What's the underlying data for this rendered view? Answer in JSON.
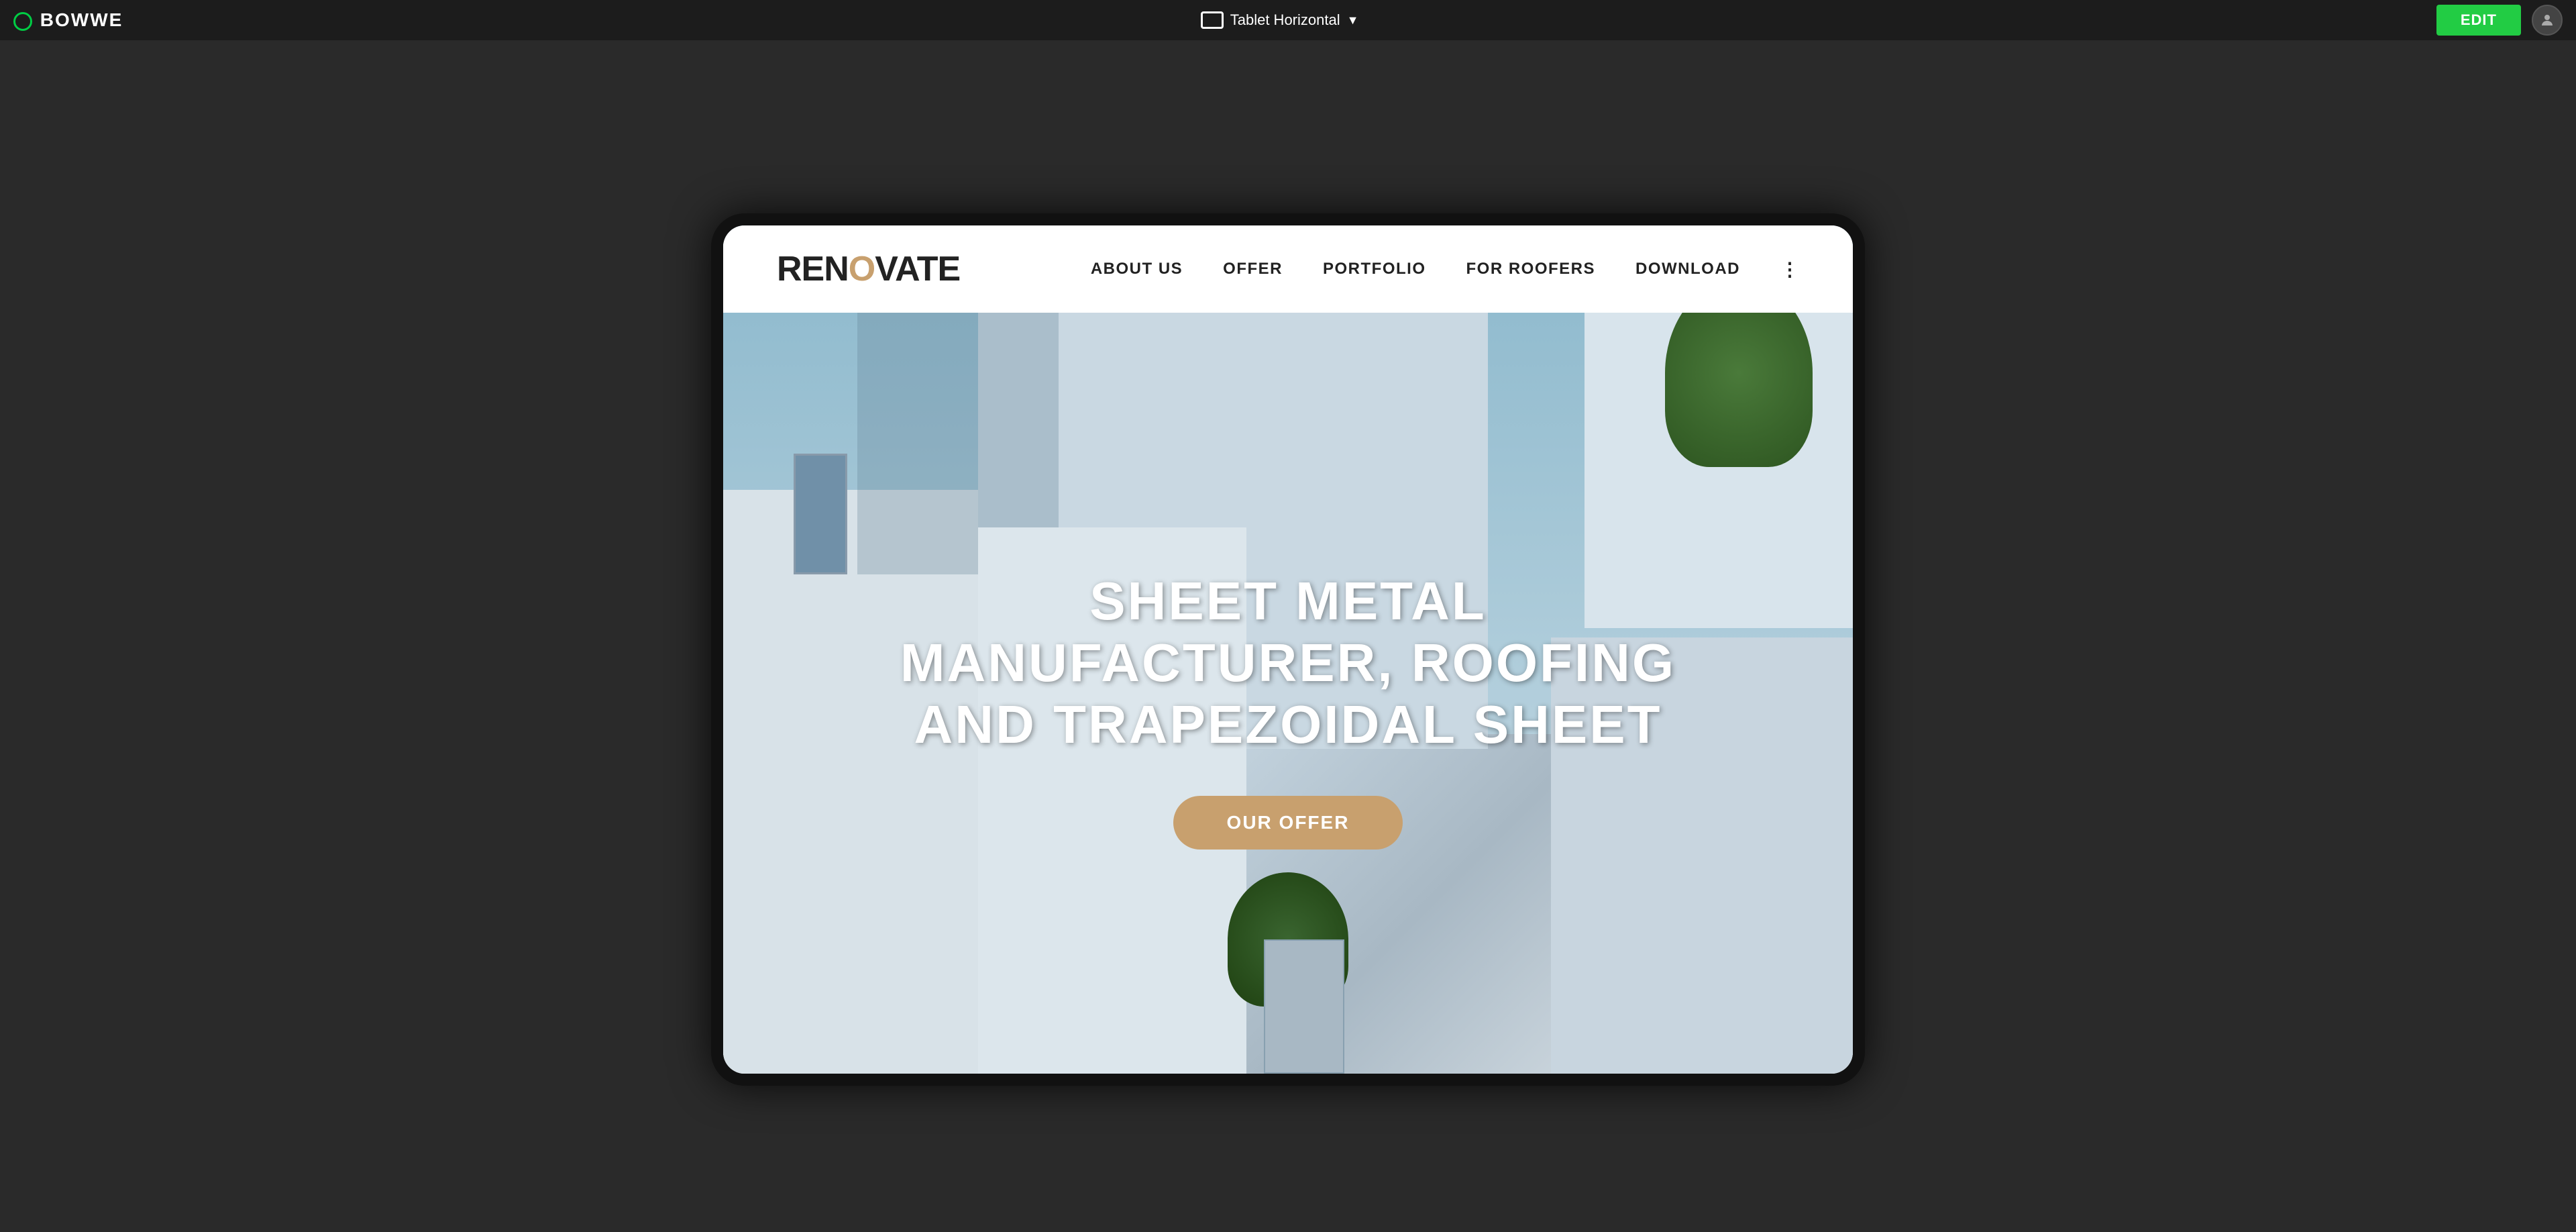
{
  "toolbar": {
    "logo_text": "BOWWE",
    "device_label": "Tablet Horizontal",
    "edit_label": "EDIT"
  },
  "site": {
    "logo": {
      "part1": "REN",
      "o_char": "O",
      "part2": "VATE"
    },
    "nav": {
      "links": [
        {
          "label": "ABOUT US"
        },
        {
          "label": "OFFER"
        },
        {
          "label": "PORTFOLIO"
        },
        {
          "label": "FOR ROOFERS"
        },
        {
          "label": "DOWNLOAD"
        }
      ]
    },
    "hero": {
      "title_line1": "SHEET METAL MANUFACTURER, ROOFING",
      "title_line2": "AND TRAPEZOIDAL SHEET",
      "cta_label": "OUR OFFER"
    }
  }
}
